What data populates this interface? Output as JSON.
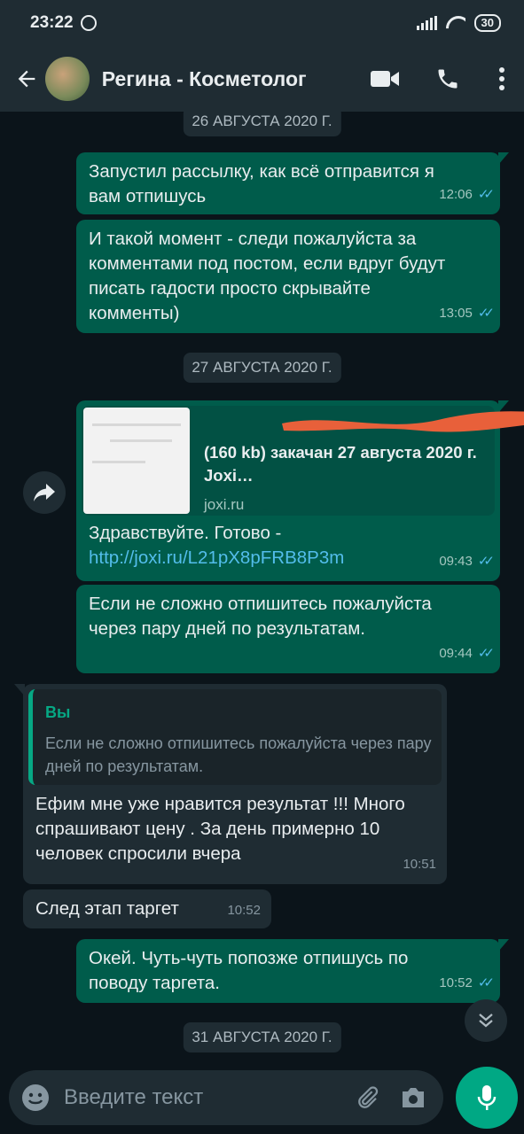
{
  "status_bar": {
    "time": "23:22",
    "battery": "30"
  },
  "header": {
    "contact_name": "Регина - Косметолог"
  },
  "dates": [
    "26 АВГУСТА 2020 Г.",
    "27 АВГУСТА 2020 Г.",
    "31 АВГУСТА 2020 Г."
  ],
  "messages": [
    {
      "direction": "out",
      "text": "Запустил рассылку, как всё отправится я вам отпишусь",
      "time": "12:06"
    },
    {
      "direction": "out",
      "text": "И такой момент - следи пожалуйста за комментами под постом, если вдруг будут писать гадости просто скрывайте комменты)",
      "time": "13:05"
    },
    {
      "direction": "out",
      "link_title": "(160 kb) закачан 27 августа 2020 г. Joxi…",
      "link_domain": "joxi.ru",
      "text_prefix": "Здравствуйте. Готово - ",
      "link_url": "http://joxi.ru/L21pX8pFRB8P3m",
      "time": "09:43"
    },
    {
      "direction": "out",
      "text": "Если не сложно отпишитесь пожалуйста через пару дней по результатам.",
      "time": "09:44"
    },
    {
      "direction": "in",
      "quote_author": "Вы",
      "quote_text": "Если не сложно отпишитесь пожалуйста через пару дней по результатам.",
      "text": "Ефим мне уже нравится результат !!! Много спрашивают цену . За день примерно 10 человек спросили вчера",
      "time": "10:51"
    },
    {
      "direction": "in",
      "text": "След этап таргет",
      "time": "10:52"
    },
    {
      "direction": "out",
      "text": "Окей. Чуть-чуть попозже отпишусь по поводу таргета.",
      "time": "10:52"
    }
  ],
  "input": {
    "placeholder": "Введите текст"
  },
  "colors": {
    "outgoing_bubble": "#005c4b",
    "incoming_bubble": "#1f2c33",
    "accent": "#00a884",
    "read_ticks": "#53bdeb"
  },
  "icons": [
    "back-arrow-icon",
    "video-call-icon",
    "phone-icon",
    "more-vert-icon",
    "forward-icon",
    "chevron-down-icon",
    "emoji-icon",
    "attach-icon",
    "camera-icon",
    "mic-icon"
  ]
}
